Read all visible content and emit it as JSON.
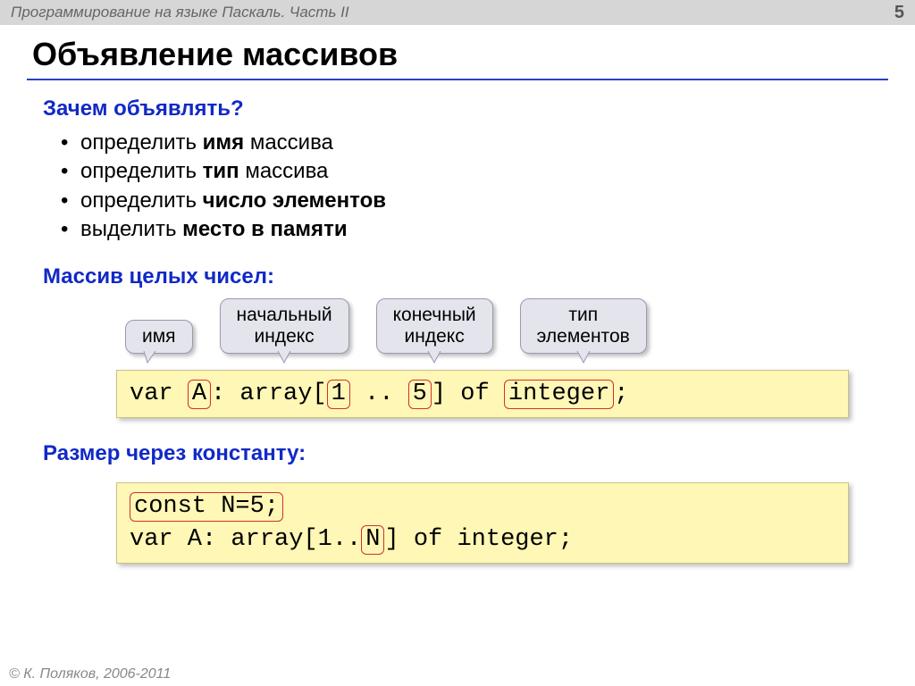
{
  "header": {
    "course": "Программирование на языке Паскаль. Часть II",
    "page": "5"
  },
  "title": "Объявление массивов",
  "why": {
    "heading": "Зачем объявлять?",
    "items": [
      {
        "pre": "определить ",
        "bold": "имя",
        "post": " массива"
      },
      {
        "pre": "определить ",
        "bold": "тип",
        "post": " массива"
      },
      {
        "pre": "определить ",
        "bold": "число элементов",
        "post": ""
      },
      {
        "pre": "выделить ",
        "bold": "место в памяти",
        "post": ""
      }
    ]
  },
  "intArray": {
    "heading": "Массив целых чисел:",
    "callouts": {
      "name": "имя",
      "start": "начальный\nиндекс",
      "end": "конечный\nиндекс",
      "type": "тип\nэлементов"
    },
    "code": {
      "p0": "var ",
      "a": "A",
      "p1": ": array[",
      "one": "1",
      "p2": " .. ",
      "five": "5",
      "p3": "] of ",
      "int": "integer",
      "p4": ";"
    }
  },
  "constSize": {
    "heading": "Размер через константу:",
    "code": {
      "line1": "const N=5;",
      "l2a": "var A: array[1..",
      "n": "N",
      "l2b": "] of integer;"
    }
  },
  "footer": "© К. Поляков, 2006-2011"
}
